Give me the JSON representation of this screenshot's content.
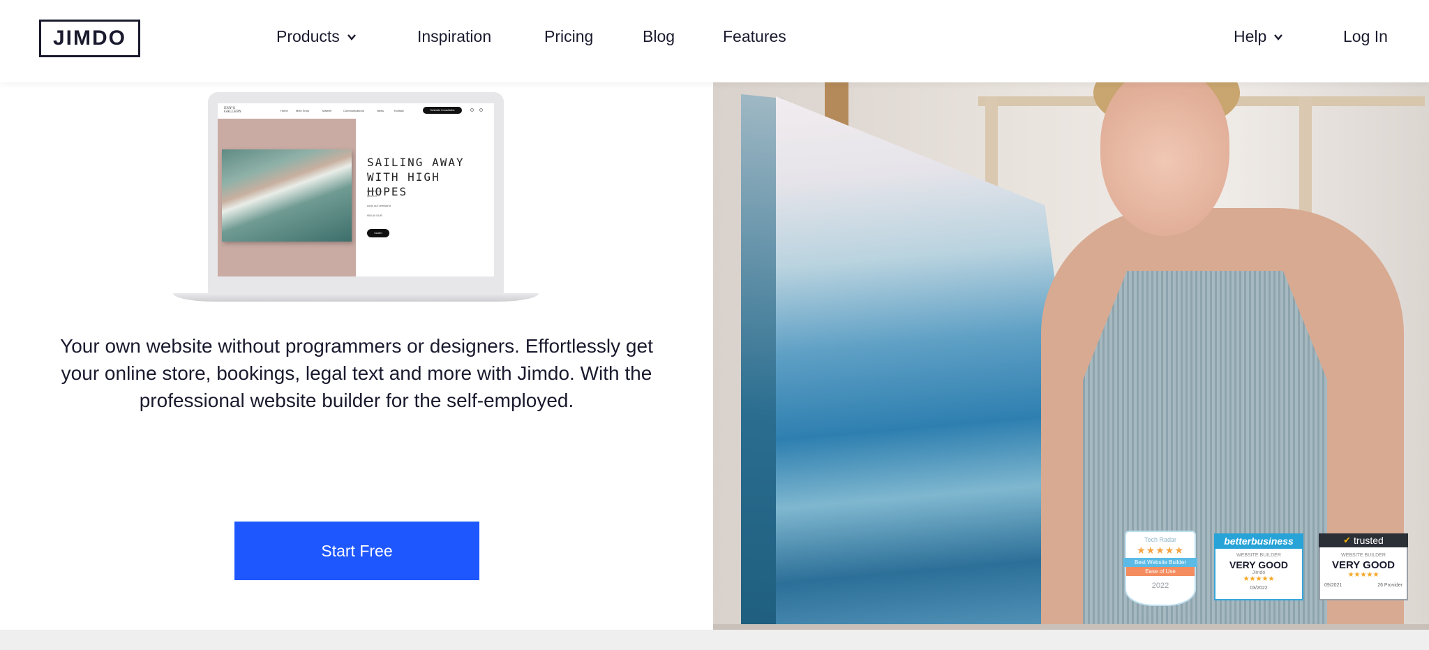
{
  "header": {
    "logo": "JIMDO",
    "nav": {
      "products": "Products",
      "inspiration": "Inspiration",
      "pricing": "Pricing",
      "blog": "Blog",
      "features": "Features",
      "help": "Help",
      "login": "Log In"
    }
  },
  "laptop_preview": {
    "brand": "ENY'S\nGALLERY",
    "nav_links": [
      "Home",
      "Mein Shop",
      "Malerei",
      "Communications",
      "News",
      "Kontakt"
    ],
    "cta_pill": "Schedule Consultation",
    "title": "SAILING AWAY WITH HIGH HOPES",
    "details": [
      "80 x 120 cm",
      "08/2019",
      "",
      "Acryl auf Leinwand",
      "",
      "950,00 EUR"
    ],
    "buy_label": "Kaufen"
  },
  "hero": {
    "text": "Your own website without programmers or designers. Effortlessly get your online store, bookings, legal text and more with Jimdo. With the professional website builder for the self-employed.",
    "cta": "Start Free"
  },
  "badges": {
    "techradar": {
      "top": "Tech Radar",
      "stars": "★★★★★",
      "line1": "Best Website Builder",
      "line2": "Ease of Use",
      "year": "2022"
    },
    "betterbusiness": {
      "head": "betterbusiness",
      "sub": "WEBSITE BUILDER",
      "rating": "VERY GOOD",
      "name": "Jimdo",
      "stars": "★★★★★",
      "date": "03/2022"
    },
    "trusted": {
      "head": "trusted",
      "sub": "WEBSITE BUILDER",
      "rating": "VERY GOOD",
      "stars": "★★★★★",
      "date": "09/2021",
      "providers": "26 Provider"
    }
  },
  "colors": {
    "accent": "#1f57ff",
    "text": "#1a1a2e",
    "footer_band": "#efefef"
  }
}
